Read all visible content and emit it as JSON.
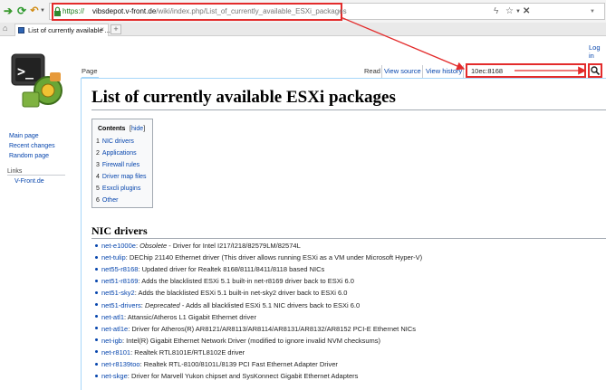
{
  "browser": {
    "url_scheme": "https://",
    "url_domain": "vibsdepot.v-front.de",
    "url_path": "/wiki/index.php/List_of_currently_available_ESXi_packages",
    "tab_title": "List of currently available ...",
    "tab_close": "×",
    "new_tab": "+",
    "highlight_color": "#e32b2b"
  },
  "wiki": {
    "login": "Log in",
    "ns_tab": "Page",
    "view_tabs": [
      "Read",
      "View source",
      "View history"
    ],
    "search_value": "10ec:8168",
    "sidebar": {
      "nav": [
        "Main page",
        "Recent changes",
        "Random page"
      ],
      "links_heading": "Links",
      "links": [
        "V-Front.de"
      ]
    },
    "page_title": "List of currently available ESXi packages",
    "toc": {
      "title": "Contents",
      "hide_open": "[",
      "hide": "hide",
      "hide_close": "]",
      "items": [
        {
          "num": "1",
          "label": "NIC drivers"
        },
        {
          "num": "2",
          "label": "Applications"
        },
        {
          "num": "3",
          "label": "Firewall rules"
        },
        {
          "num": "4",
          "label": "Driver map files"
        },
        {
          "num": "5",
          "label": "Esxcli plugins"
        },
        {
          "num": "6",
          "label": "Other"
        }
      ]
    },
    "section_heading": "NIC drivers",
    "drivers": [
      {
        "name": "net-e1000e",
        "sep": ": ",
        "deprecated": "Obsolete",
        "desc": " - Driver for Intel I217/I218/82579LM/82574L"
      },
      {
        "name": "net-tulip",
        "sep": ": ",
        "deprecated": "",
        "desc": "DEChip 21140 Ethernet driver (This driver allows running ESXi as a VM under Microsoft Hyper-V)"
      },
      {
        "name": "net55-r8168",
        "sep": ": ",
        "deprecated": "",
        "desc": "Updated driver for Realtek 8168/8111/8411/8118 based NICs"
      },
      {
        "name": "net51-r8169",
        "sep": ": ",
        "deprecated": "",
        "desc": "Adds the blacklisted ESXi 5.1 built-in net-r8169 driver back to ESXi 6.0"
      },
      {
        "name": "net51-sky2",
        "sep": ": ",
        "deprecated": "",
        "desc": "Adds the blacklisted ESXi 5.1 built-in net-sky2 driver back to ESXi 6.0"
      },
      {
        "name": "net51-drivers",
        "sep": ": ",
        "deprecated": "Deprecated",
        "desc": " - Adds all blacklisted ESXi 5.1 NIC drivers back to ESXi 6.0"
      },
      {
        "name": "net-atl1",
        "sep": ": ",
        "deprecated": "",
        "desc": "Attansic/Atheros L1 Gigabit Ethernet driver"
      },
      {
        "name": "net-atl1e",
        "sep": ": ",
        "deprecated": "",
        "desc": "Driver for Atheros(R) AR8121/AR8113/AR8114/AR8131/AR8132/AR8152 PCI-E Ethernet NICs"
      },
      {
        "name": "net-igb",
        "sep": ": ",
        "deprecated": "",
        "desc": "Intel(R) Gigabit Ethernet Network Driver (modified to ignore invalid NVM checksums)"
      },
      {
        "name": "net-r8101",
        "sep": ": ",
        "deprecated": "",
        "desc": "Realtek RTL8101E/RTL8102E driver"
      },
      {
        "name": "net-r8139too",
        "sep": ": ",
        "deprecated": "",
        "desc": "Realtek RTL-8100/8101L/8139 PCI Fast Ethernet Adapter Driver"
      },
      {
        "name": "net-skge",
        "sep": ": ",
        "deprecated": "",
        "desc": "Driver for Marvell Yukon chipset and SysKonnect Gigabit Ethernet Adapters"
      }
    ]
  }
}
